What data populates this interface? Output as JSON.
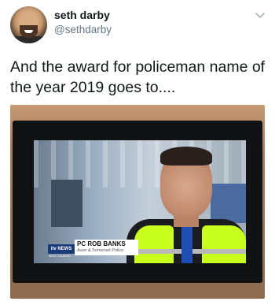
{
  "user": {
    "display_name": "seth darby",
    "handle": "@sethdarby"
  },
  "tweet": {
    "text": "And the award for policeman name of the year 2019 goes to...."
  },
  "media": {
    "caption_title": "PC ROB BANKS",
    "caption_subtitle": "Avon & Somerset Police",
    "channel_logo": "itv NEWS",
    "channel_region": "WEST COUNTRY"
  },
  "icons": {
    "menu": "chevron-down-icon"
  },
  "colors": {
    "name": "#14171a",
    "handle": "#657786",
    "hiviz": "#c9ff1e",
    "itv_blue": "#1b3a78"
  }
}
